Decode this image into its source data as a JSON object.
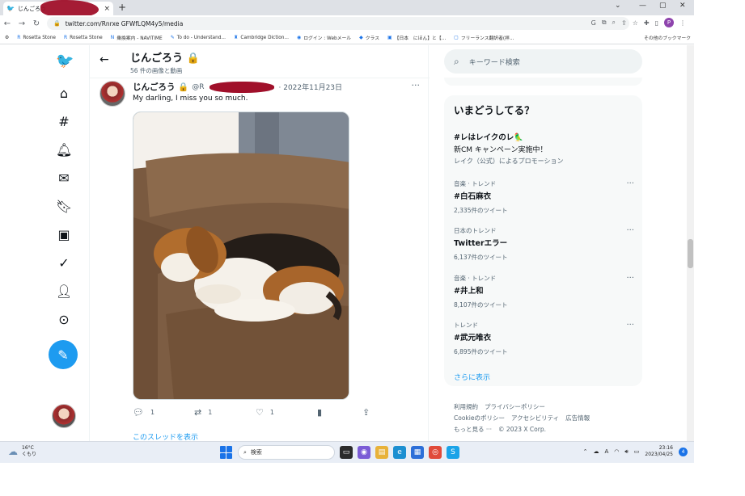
{
  "browser": {
    "tab_title": "じんごろう",
    "tab_close": "×",
    "new_tab": "+",
    "url": "twitter.com/Rnrxe GFWfLQM4y5/media",
    "window_controls": [
      "⌄",
      "—",
      "▢",
      "✕"
    ]
  },
  "bookmarks": {
    "items": [
      {
        "label": "Rosetta Stone",
        "icon": "R"
      },
      {
        "label": "Rosetta Stone",
        "icon": "R"
      },
      {
        "label": "乗換案内 - NAVITIME",
        "icon": "N"
      },
      {
        "label": "To do - Understand...",
        "icon": "✎"
      },
      {
        "label": "Cambridge Diction...",
        "icon": "♜"
      },
      {
        "label": "ログイン : Webメール",
        "icon": "◉"
      },
      {
        "label": "クラス",
        "icon": "◆"
      },
      {
        "label": "【日本　にほん】と【...",
        "icon": "▣"
      },
      {
        "label": "フリーランス翻訳者(拝...",
        "icon": "▢"
      }
    ],
    "other": "その他のブックマーク"
  },
  "profile_header": {
    "name": "じんごろう 🔒",
    "subtitle": "56 件の画像と動画"
  },
  "tweet": {
    "name": "じんごろう 🔒",
    "handle_prefix": "@R",
    "date": "· 2022年11月23日",
    "text": "My darling, I miss you so much.",
    "more": "···",
    "replies": "1",
    "retweets": "1",
    "likes": "1",
    "show_thread": "このスレッドを表示"
  },
  "search": {
    "placeholder": "キーワード検索"
  },
  "trends": {
    "title": "いまどうしてる？",
    "promo": {
      "title": "#レはレイクのレ🦜",
      "desc": "新CM キャンペーン実施中！",
      "by": "レイク（公式）によるプロモーション"
    },
    "items": [
      {
        "context": "音楽 · トレンド",
        "name": "#白石麻衣",
        "count": "2,335件のツイート"
      },
      {
        "context": "日本のトレンド",
        "name": "Twitterエラー",
        "count": "6,137件のツイート"
      },
      {
        "context": "音楽 · トレンド",
        "name": "#井上和",
        "count": "8,107件のツイート"
      },
      {
        "context": "トレンド",
        "name": "#武元唯衣",
        "count": "6,895件のツイート"
      }
    ],
    "show_more": "さらに表示"
  },
  "footer": {
    "links": [
      "利用規約",
      "プライバシーポリシー",
      "Cookieのポリシー",
      "アクセシビリティ",
      "広告情報",
      "もっと見る ···",
      "© 2023 X Corp."
    ]
  },
  "taskbar": {
    "weather_temp": "16°C",
    "weather_desc": "くもり",
    "search_label": "検索",
    "time": "23:16",
    "date": "2023/04/25",
    "notif": "4"
  },
  "colors": {
    "accent": "#1d9bf0",
    "redaction": "#a0102a"
  }
}
